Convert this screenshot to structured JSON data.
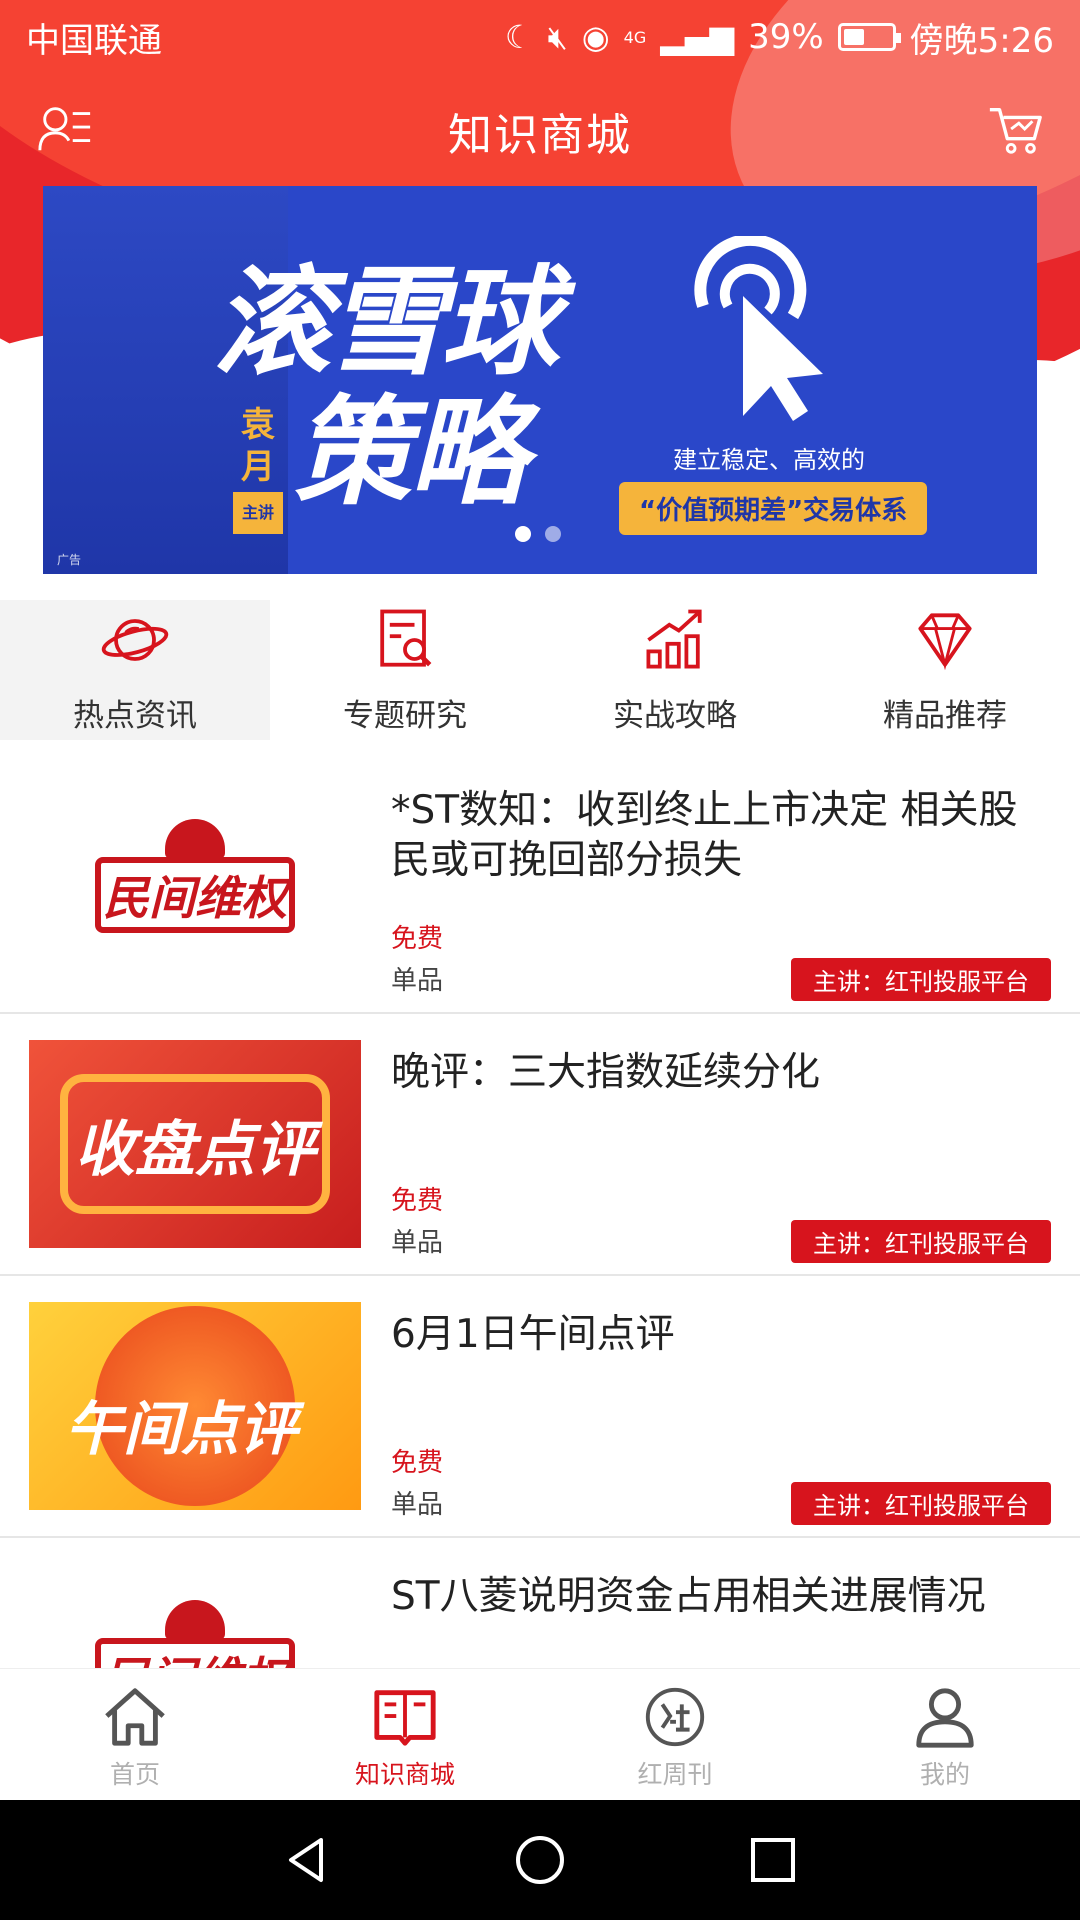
{
  "status_bar": {
    "carrier": "中国联通",
    "network": "4G",
    "battery": "39%",
    "time": "傍晚5:26"
  },
  "header": {
    "title": "知识商城"
  },
  "banner": {
    "headline_top": "滚雪球",
    "headline_bottom": "策略",
    "speaker": "袁月",
    "speaker_tag": "主讲",
    "subtitle": "建立稳定、高效的",
    "pill": "“价值预期差”交易体系",
    "ad_label": "广告"
  },
  "categories": [
    {
      "label": "热点资讯",
      "icon": "planet-icon"
    },
    {
      "label": "专题研究",
      "icon": "document-search-icon"
    },
    {
      "label": "实战攻略",
      "icon": "chart-up-icon"
    },
    {
      "label": "精品推荐",
      "icon": "diamond-icon"
    }
  ],
  "articles": [
    {
      "title": "*ST数知：收到终止上市决定 相关股民或可挽回部分损失",
      "price": "免费",
      "type": "单品",
      "host": "主讲：红刊投服平台",
      "thumb_text": "民间维权"
    },
    {
      "title": "晚评：三大指数延续分化",
      "price": "免费",
      "type": "单品",
      "host": "主讲：红刊投服平台",
      "thumb_text": "收盘点评"
    },
    {
      "title": "6月1日午间点评",
      "price": "免费",
      "type": "单品",
      "host": "主讲：红刊投服平台",
      "thumb_text": "午间点评"
    },
    {
      "title": "ST八菱说明资金占用相关进展情况",
      "price": "",
      "type": "",
      "host": "",
      "thumb_text": "民间维权"
    }
  ],
  "tabs": [
    {
      "label": "首页",
      "icon": "home-icon"
    },
    {
      "label": "知识商城",
      "icon": "book-icon"
    },
    {
      "label": "红周刊",
      "icon": "hong-seal-icon"
    },
    {
      "label": "我的",
      "icon": "person-icon"
    }
  ],
  "colors": {
    "accent": "#d7141d",
    "banner_blue": "#2a47c9",
    "banner_gold": "#f5b43b"
  }
}
